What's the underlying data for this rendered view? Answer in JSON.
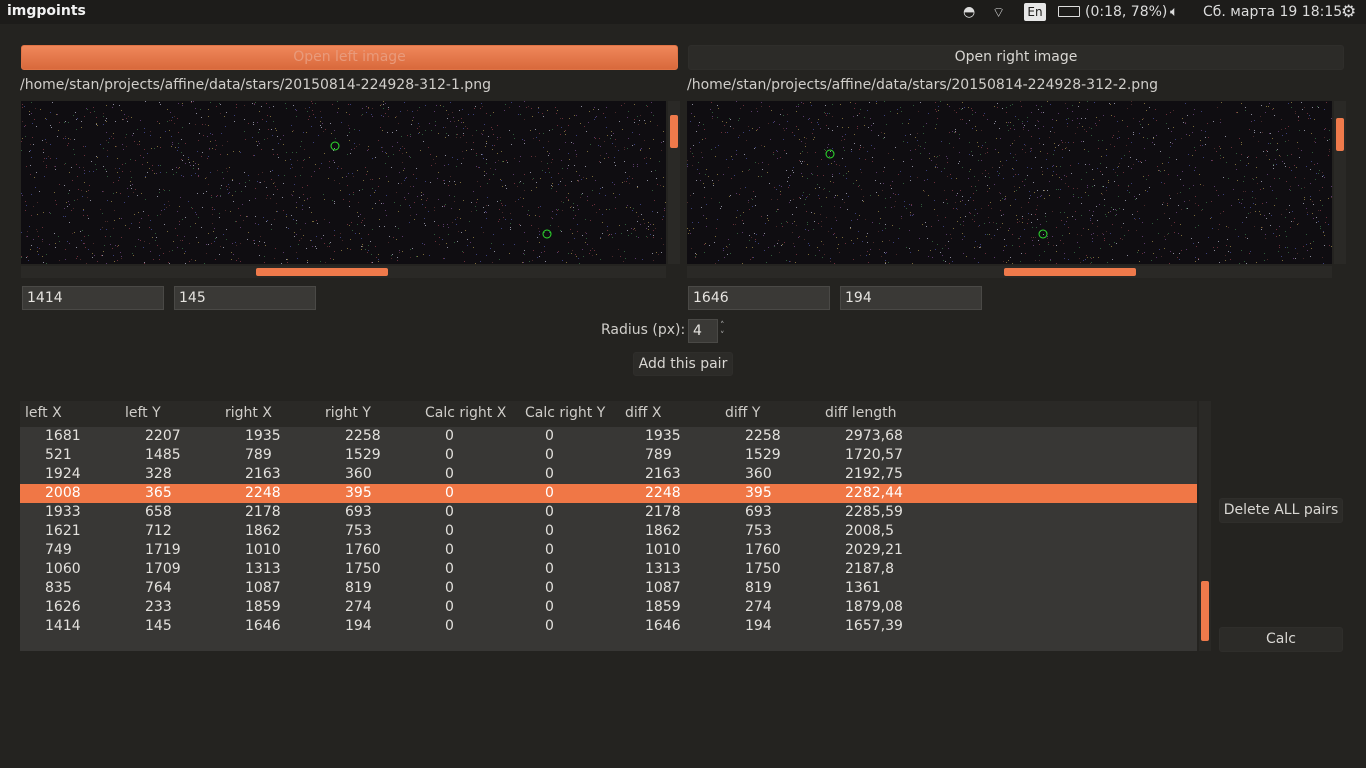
{
  "app_title": "imgpoints",
  "tray": {
    "language": "En",
    "battery": "(0:18, 78%)",
    "datetime": "Сб. марта 19 18:15"
  },
  "left": {
    "open_label": "Open left image",
    "path": "/home/stan/projects/affine/data/stars/20150814-224928-312-1.png",
    "x": "1414",
    "y": "145"
  },
  "right": {
    "open_label": "Open right image",
    "path": "/home/stan/projects/affine/data/stars/20150814-224928-312-2.png",
    "x": "1646",
    "y": "194"
  },
  "radius": {
    "label": "Radius (px):",
    "value": "4"
  },
  "add_pair_label": "Add this pair",
  "delete_all_label": "Delete ALL pairs",
  "calc_label": "Calc",
  "table": {
    "columns": [
      "left X",
      "left Y",
      "right X",
      "right Y",
      "Calc right X",
      "Calc right Y",
      "diff X",
      "diff Y",
      "diff length"
    ],
    "rows": [
      [
        "1681",
        "2207",
        "1935",
        "2258",
        "0",
        "0",
        "1935",
        "2258",
        "2973,68"
      ],
      [
        "521",
        "1485",
        "789",
        "1529",
        "0",
        "0",
        "789",
        "1529",
        "1720,57"
      ],
      [
        "1924",
        "328",
        "2163",
        "360",
        "0",
        "0",
        "2163",
        "360",
        "2192,75"
      ],
      [
        "2008",
        "365",
        "2248",
        "395",
        "0",
        "0",
        "2248",
        "395",
        "2282,44"
      ],
      [
        "1933",
        "658",
        "2178",
        "693",
        "0",
        "0",
        "2178",
        "693",
        "2285,59"
      ],
      [
        "1621",
        "712",
        "1862",
        "753",
        "0",
        "0",
        "1862",
        "753",
        "2008,5"
      ],
      [
        "749",
        "1719",
        "1010",
        "1760",
        "0",
        "0",
        "1010",
        "1760",
        "2029,21"
      ],
      [
        "1060",
        "1709",
        "1313",
        "1750",
        "0",
        "0",
        "1313",
        "1750",
        "2187,8"
      ],
      [
        "835",
        "764",
        "1087",
        "819",
        "0",
        "0",
        "1087",
        "819",
        "1361"
      ],
      [
        "1626",
        "233",
        "1859",
        "274",
        "0",
        "0",
        "1859",
        "274",
        "1879,08"
      ],
      [
        "1414",
        "145",
        "1646",
        "194",
        "0",
        "0",
        "1646",
        "194",
        "1657,39"
      ]
    ],
    "selected_row": 3
  },
  "colors": {
    "accent": "#f07746",
    "background": "#242320"
  }
}
